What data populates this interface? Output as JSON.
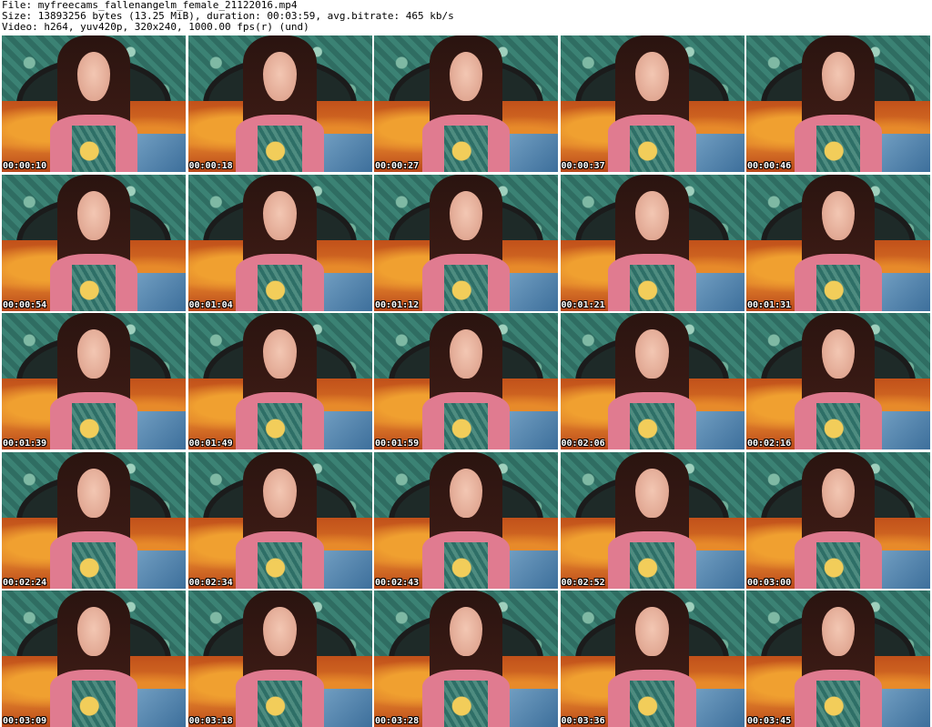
{
  "header": {
    "line1": "File: myfreecams_fallenangelm_female_21122016.mp4",
    "line2": "Size: 13893256 bytes (13.25 MiB), duration: 00:03:59, avg.bitrate: 465 kb/s",
    "line3": "Video: h264, yuv420p, 320x240, 1000.00 fps(r) (und)"
  },
  "thumbnails": [
    {
      "time": "00:00:10"
    },
    {
      "time": "00:00:18"
    },
    {
      "time": "00:00:27"
    },
    {
      "time": "00:00:37"
    },
    {
      "time": "00:00:46"
    },
    {
      "time": "00:00:54"
    },
    {
      "time": "00:01:04"
    },
    {
      "time": "00:01:12"
    },
    {
      "time": "00:01:21"
    },
    {
      "time": "00:01:31"
    },
    {
      "time": "00:01:39"
    },
    {
      "time": "00:01:49"
    },
    {
      "time": "00:01:59"
    },
    {
      "time": "00:02:06"
    },
    {
      "time": "00:02:16"
    },
    {
      "time": "00:02:24"
    },
    {
      "time": "00:02:34"
    },
    {
      "time": "00:02:43"
    },
    {
      "time": "00:02:52"
    },
    {
      "time": "00:03:00"
    },
    {
      "time": "00:03:09"
    },
    {
      "time": "00:03:18"
    },
    {
      "time": "00:03:28"
    },
    {
      "time": "00:03:36"
    },
    {
      "time": "00:03:45"
    }
  ]
}
